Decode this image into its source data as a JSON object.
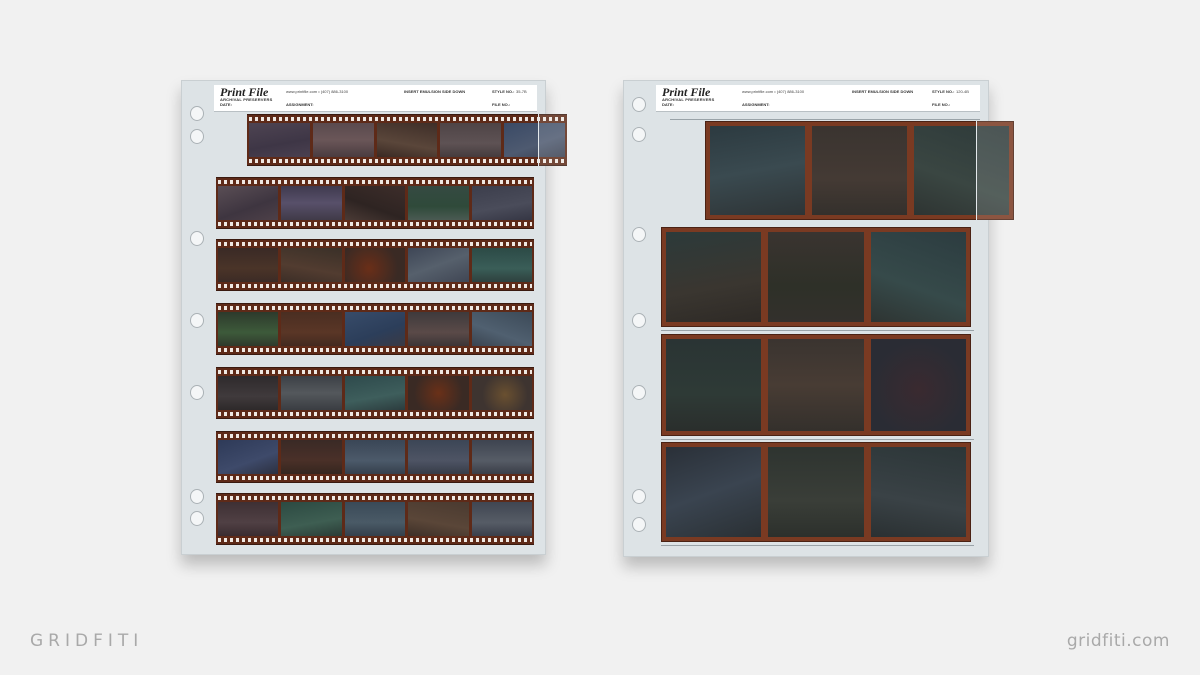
{
  "brand_left": "GRIDFITI",
  "brand_right": "gridfiti.com",
  "sheets": [
    {
      "logo_main": "Print File",
      "logo_sub": "ARCHIVAL PRESERVERS",
      "contact": "www.printfile.com • (407) 886-3100",
      "instruction": "INSERT EMULSION SIDE DOWN",
      "style_label": "STYLE NO.:",
      "style_value": "35-7B",
      "date_label": "DATE:",
      "assignment_label": "ASSIGNMENT:",
      "file_label": "FILE NO.:"
    },
    {
      "logo_main": "Print File",
      "logo_sub": "ARCHIVAL PRESERVERS",
      "contact": "www.printfile.com • (407) 886-3100",
      "instruction": "INSERT EMULSION SIDE DOWN",
      "style_label": "STYLE NO.:",
      "style_value": "120-4B",
      "date_label": "DATE:",
      "assignment_label": "ASSIGNMENT:",
      "file_label": "FILE NO.:"
    }
  ],
  "colors": {
    "background": "#f1f1f1",
    "sleeve": "#dde3e6",
    "film_base": "#5e2a18",
    "film_120": "#7a3a22"
  }
}
